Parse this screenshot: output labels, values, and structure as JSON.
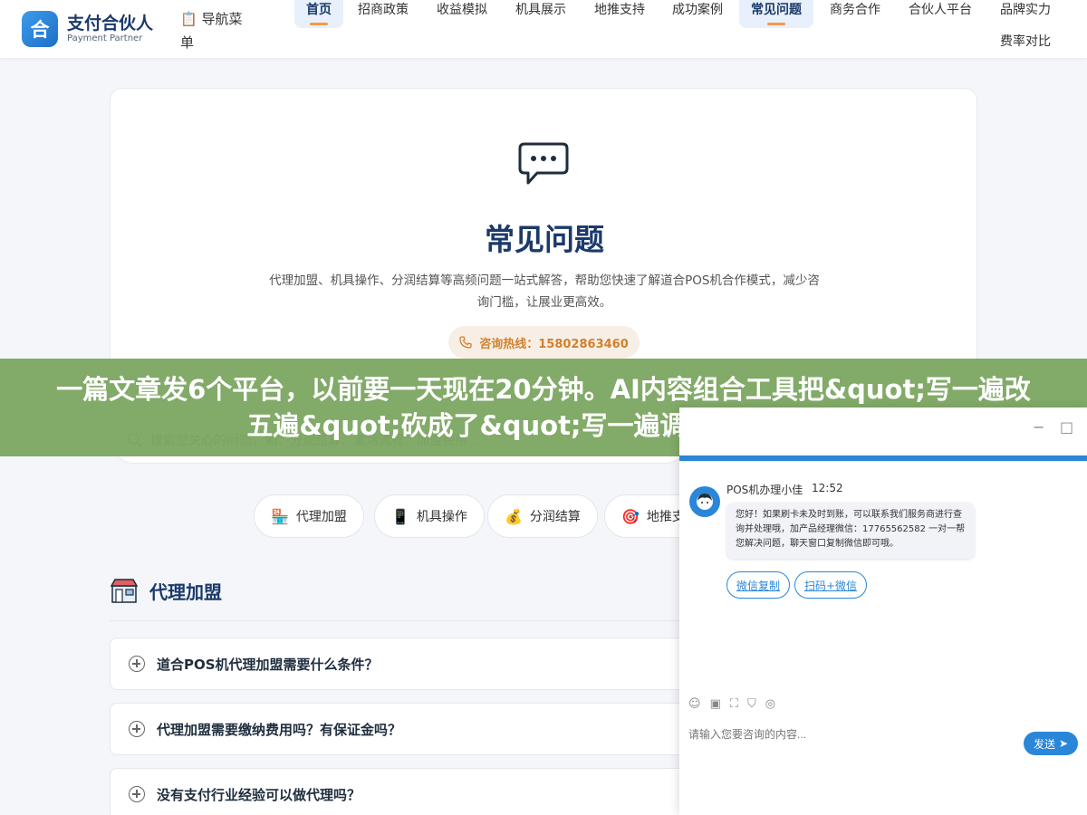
{
  "header": {
    "logo_mark": "合",
    "logo_title": "支付合伙人",
    "logo_sub": "Payment Partner",
    "nav_menu_label": "导航菜单",
    "nav": [
      {
        "label": "首页",
        "active": true
      },
      {
        "label": "招商政策"
      },
      {
        "label": "收益模拟"
      },
      {
        "label": "机具展示"
      },
      {
        "label": "地推支持"
      },
      {
        "label": "成功案例"
      },
      {
        "label": "常见问题",
        "active": true
      },
      {
        "label": "商务合作"
      },
      {
        "label": "合伙人平台"
      },
      {
        "label": "品牌实力"
      },
      {
        "label": "费率对比"
      }
    ]
  },
  "hero": {
    "icon": "chat-bubble-icon",
    "title": "常见问题",
    "desc": "代理加盟、机具操作、分润结算等高频问题一站式解答，帮助您快速了解道合POS机合作模式，减少咨询门槛，让展业更高效。",
    "hotline_label": "咨询热线：15802863460"
  },
  "search": {
    "placeholder": "搜索您关心的问题，如：分润结算、激活流程、加盟费用…"
  },
  "chips": [
    {
      "icon": "🏪",
      "label": "代理加盟"
    },
    {
      "icon": "📱",
      "label": "机具操作"
    },
    {
      "icon": "💰",
      "label": "分润结算"
    },
    {
      "icon": "🎯",
      "label": "地推支"
    }
  ],
  "section": {
    "title": "代理加盟",
    "faqs": [
      "道合POS机代理加盟需要什么条件？",
      "代理加盟需要缴纳费用吗？有保证金吗？",
      "没有支付行业经验可以做代理吗？"
    ]
  },
  "banner": {
    "text": "一篇文章发6个平台，以前要一天现在20分钟。AI内容组合工具把&quot;写一遍改五遍&quot;砍成了&quot;写一遍调一遍&quot;"
  },
  "chat": {
    "agent_name": "POS机办理小佳",
    "time": "12:52",
    "message": "您好！如果刷卡未及时到账，可以联系我们服务商进行查询并处理哦，加产品经理微信：17765562582 一对一帮您解决问题，聊天窗口复制微信即可哦。",
    "quick_replies": [
      "微信复制",
      "扫码+微信"
    ],
    "input_placeholder": "请输入您要咨询的内容...",
    "send_label": "发送",
    "minimize": "−",
    "maximize": "□"
  },
  "colors": {
    "brand": "#1b3a6b",
    "accent": "#2a86d8",
    "banner": "#7aa55f",
    "hotline": "#d2802d"
  }
}
